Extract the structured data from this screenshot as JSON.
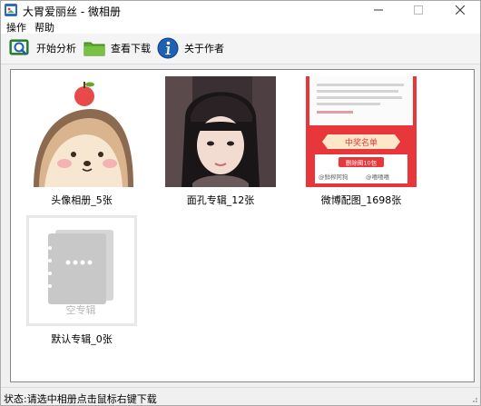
{
  "window": {
    "title": "大胃爱丽丝 - 微相册",
    "controls": {
      "minimize": "minimize",
      "maximize": "maximize",
      "close": "close"
    }
  },
  "menu": {
    "items": [
      "操作",
      "帮助"
    ]
  },
  "toolbar": {
    "analyze_label": "开始分析",
    "downloads_label": "查看下载",
    "about_label": "关于作者"
  },
  "albums": [
    {
      "caption": "头像相册_5张",
      "thumb": "hedgehog-cartoon"
    },
    {
      "caption": "面孔专辑_12张",
      "thumb": "girl-portrait"
    },
    {
      "caption": "微博配图_1698张",
      "thumb": "weibo-promo"
    },
    {
      "caption": "默认专辑_0张",
      "thumb": "empty-album"
    }
  ],
  "thumb_text": {
    "promo_banner": "中奖名单",
    "promo_button": "删除图10包",
    "promo_user1": "@鲜榨阿狗",
    "promo_user2": "@嘻嘻嘻",
    "empty_label": "空专辑"
  },
  "status": {
    "text": "状态:请选中相册点击鼠标右键下载"
  },
  "colors": {
    "window_bg": "#f0f0f0",
    "content_bg": "#ffffff",
    "promo_red": "#e8373a",
    "toolbar_blue": "#1f5fb4",
    "folder_green": "#5fa82e"
  }
}
